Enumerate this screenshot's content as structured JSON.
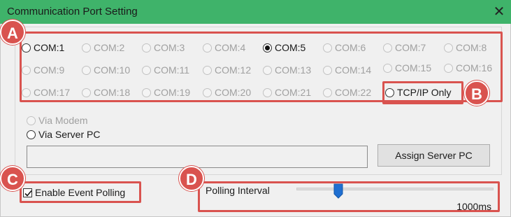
{
  "window": {
    "title": "Communication Port Setting",
    "close_glyph": "✕",
    "titlebar_color": "#3fb36a"
  },
  "com_ports": [
    {
      "label": "COM:1",
      "enabled": true,
      "checked": false
    },
    {
      "label": "COM:2",
      "enabled": false,
      "checked": false
    },
    {
      "label": "COM:3",
      "enabled": false,
      "checked": false
    },
    {
      "label": "COM:4",
      "enabled": false,
      "checked": false
    },
    {
      "label": "COM:5",
      "enabled": true,
      "checked": true
    },
    {
      "label": "COM:6",
      "enabled": false,
      "checked": false
    },
    {
      "label": "COM:7",
      "enabled": false,
      "checked": false
    },
    {
      "label": "COM:8",
      "enabled": false,
      "checked": false
    },
    {
      "label": "COM:9",
      "enabled": false,
      "checked": false
    },
    {
      "label": "COM:10",
      "enabled": false,
      "checked": false
    },
    {
      "label": "COM:11",
      "enabled": false,
      "checked": false
    },
    {
      "label": "COM:12",
      "enabled": false,
      "checked": false
    },
    {
      "label": "COM:13",
      "enabled": false,
      "checked": false
    },
    {
      "label": "COM:14",
      "enabled": false,
      "checked": false
    },
    {
      "label": "COM:15",
      "enabled": false,
      "checked": false
    },
    {
      "label": "COM:16",
      "enabled": false,
      "checked": false
    },
    {
      "label": "COM:17",
      "enabled": false,
      "checked": false
    },
    {
      "label": "COM:18",
      "enabled": false,
      "checked": false
    },
    {
      "label": "COM:19",
      "enabled": false,
      "checked": false
    },
    {
      "label": "COM:20",
      "enabled": false,
      "checked": false
    },
    {
      "label": "COM:21",
      "enabled": false,
      "checked": false
    },
    {
      "label": "COM:22",
      "enabled": false,
      "checked": false
    }
  ],
  "tcpip": {
    "label": "TCP/IP Only",
    "checked": false
  },
  "connection": {
    "via_modem": "Via Modem",
    "via_server_pc": "Via Server PC",
    "server_field_value": "",
    "assign_button": "Assign Server PC"
  },
  "polling": {
    "enable_label": "Enable Event Polling",
    "enabled": true,
    "interval_label": "Polling Interval",
    "interval_value": "1000ms",
    "slider_fraction": 0.22
  },
  "annotations": {
    "badges": [
      "A",
      "B",
      "C",
      "D"
    ],
    "color": "#d9534f"
  }
}
